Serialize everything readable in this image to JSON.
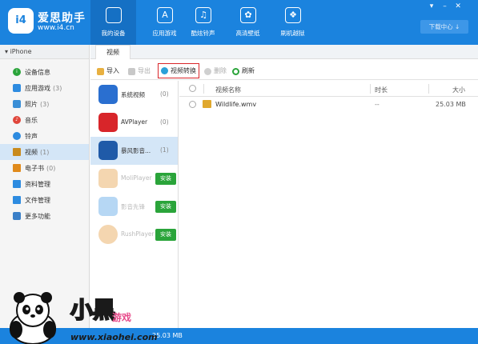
{
  "app": {
    "brand_name": "爱思助手",
    "brand_url": "www.i4.cn",
    "logo_text": "i4"
  },
  "nav": [
    {
      "label": "我的设备",
      "icon": "apple-icon",
      "glyph": "",
      "active": true
    },
    {
      "label": "应用游戏",
      "icon": "app-store-icon",
      "glyph": "A"
    },
    {
      "label": "酷炫铃声",
      "icon": "music-note-icon",
      "glyph": "♫"
    },
    {
      "label": "高清壁纸",
      "icon": "wallpaper-flower-icon",
      "glyph": "✿"
    },
    {
      "label": "刷机越狱",
      "icon": "dropbox-icon",
      "glyph": "❖"
    }
  ],
  "window_controls": [
    "▾",
    "–",
    "✕"
  ],
  "download_center": "下载中心 ↓",
  "device_name": "iPhone",
  "device_toggle": "▾",
  "sidebar": [
    {
      "label": "设备信息",
      "count": "",
      "icon": "info-icon",
      "color": "#2aa43a"
    },
    {
      "label": "应用游戏",
      "count": "(3)",
      "icon": "apps-icon",
      "color": "#2d8be0"
    },
    {
      "label": "照片",
      "count": "(3)",
      "icon": "photo-icon",
      "color": "#3a8ed6"
    },
    {
      "label": "音乐",
      "count": "",
      "icon": "music-icon",
      "color": "#e0463b"
    },
    {
      "label": "铃声",
      "count": "",
      "icon": "bell-icon",
      "color": "#2d8be0"
    },
    {
      "label": "视频",
      "count": "(1)",
      "icon": "video-icon",
      "color": "#c98a1c",
      "active": true
    },
    {
      "label": "电子书",
      "count": "(0)",
      "icon": "ebook-icon",
      "color": "#e08a1c"
    },
    {
      "label": "资料管理",
      "count": "",
      "icon": "data-icon",
      "color": "#2d8be0"
    },
    {
      "label": "文件管理",
      "count": "",
      "icon": "file-icon",
      "color": "#2d8be0"
    },
    {
      "label": "更多功能",
      "count": "",
      "icon": "more-icon",
      "color": "#3a7fc8"
    }
  ],
  "tab": "视频",
  "toolbar": {
    "import": "导入",
    "export": "导出",
    "convert": "视频转换",
    "delete": "删除",
    "refresh": "刷新"
  },
  "players": [
    {
      "name": "系统视频",
      "count": "(0)",
      "icon": "clapperboard-icon",
      "color": "#2a6fd0"
    },
    {
      "name": "AVPlayer",
      "count": "(0)",
      "icon": "avplayer-icon",
      "color": "#d8252a"
    },
    {
      "name": "暴风影音...",
      "count": "(1)",
      "icon": "film-icon",
      "color": "#1f5aa8",
      "active": true
    },
    {
      "name": "MoliPlayer",
      "count": "",
      "icon": "moliplayer-icon",
      "color": "#e08a1c",
      "install": "安装"
    },
    {
      "name": "影音先锋",
      "count": "",
      "icon": "xianfeng-icon",
      "color": "#2d8be0",
      "install": "安装"
    },
    {
      "name": "RushPlayer",
      "count": "",
      "icon": "rushplayer-icon",
      "color": "#e08a1c",
      "install": "安装"
    }
  ],
  "table": {
    "headers": {
      "name": "视频名称",
      "duration": "时长",
      "size": "大小"
    },
    "rows": [
      {
        "name": "Wildlife.wmv",
        "duration": "--",
        "size": "25.03 MB"
      }
    ]
  },
  "status": {
    "text": "25.03 MB"
  },
  "watermark": {
    "title": "小黑",
    "subtitle": "游戏",
    "url": "www.xiaohei.com"
  }
}
